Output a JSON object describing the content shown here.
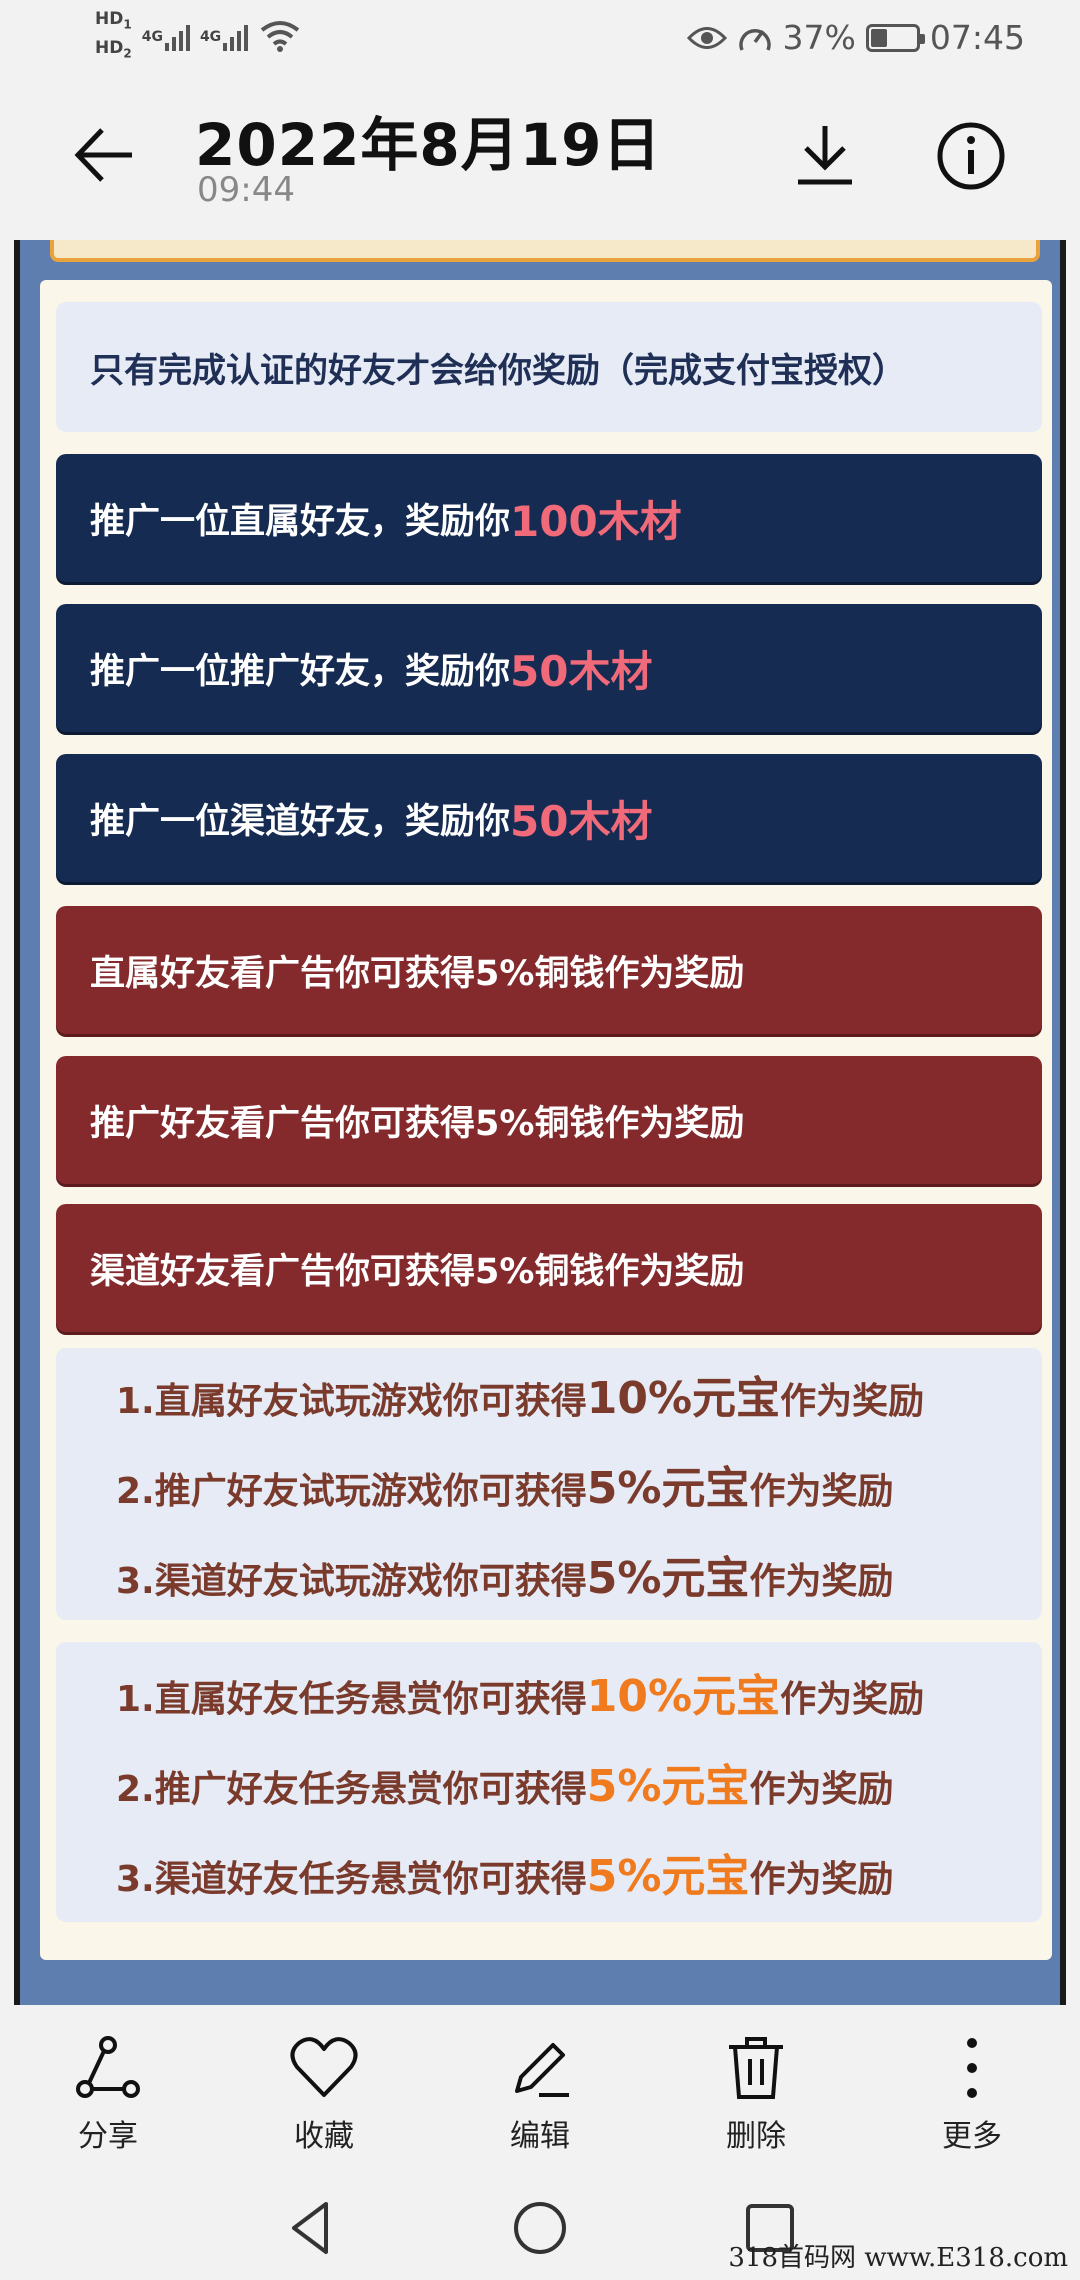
{
  "status_bar": {
    "hd1": "HD",
    "hd1_sub": "1",
    "hd2": "HD",
    "hd2_sub": "2",
    "net1": "4G",
    "net2": "4G",
    "battery_percent": "37%",
    "battery_level": 0.37,
    "time": "07:45"
  },
  "header": {
    "title": "2022年8月19日",
    "subtitle": "09:44"
  },
  "poster": {
    "notice": "只有完成认证的好友才会给你奖励（完成支付宝授权）",
    "blue_boxes": [
      {
        "text": "推广一位直属好友，奖励你",
        "highlight": "100木材"
      },
      {
        "text": "推广一位推广好友，奖励你",
        "highlight": "50木材"
      },
      {
        "text": "推广一位渠道好友，奖励你",
        "highlight": "50木材"
      }
    ],
    "red_boxes": [
      "直属好友看广告你可获得5%铜钱作为奖励",
      "推广好友看广告你可获得5%铜钱作为奖励",
      "渠道好友看广告你可获得5%铜钱作为奖励"
    ],
    "game_lines": [
      {
        "pre": "1.直属好友试玩游戏你可获得",
        "hl": "10%元宝",
        "post": "作为奖励"
      },
      {
        "pre": "2.推广好友试玩游戏你可获得",
        "hl": "5%元宝",
        "post": "作为奖励"
      },
      {
        "pre": "3.渠道好友试玩游戏你可获得",
        "hl": "5%元宝",
        "post": "作为奖励"
      }
    ],
    "task_lines": [
      {
        "pre": "1.直属好友任务悬赏你可获得",
        "hl": "10%元宝",
        "post": "作为奖励"
      },
      {
        "pre": "2.推广好友任务悬赏你可获得",
        "hl": "5%元宝",
        "post": "作为奖励"
      },
      {
        "pre": "3.渠道好友任务悬赏你可获得",
        "hl": "5%元宝",
        "post": "作为奖励"
      }
    ]
  },
  "actions": {
    "share": "分享",
    "favorite": "收藏",
    "edit": "编辑",
    "delete": "删除",
    "more": "更多"
  },
  "watermark": "318首码网 www.E318.com",
  "colors": {
    "navy": "#152b52",
    "maroon": "#842a2d",
    "pink_highlight": "#f06a7a",
    "orange_highlight": "#f07a1e",
    "poster_bg": "#5d7eae"
  }
}
